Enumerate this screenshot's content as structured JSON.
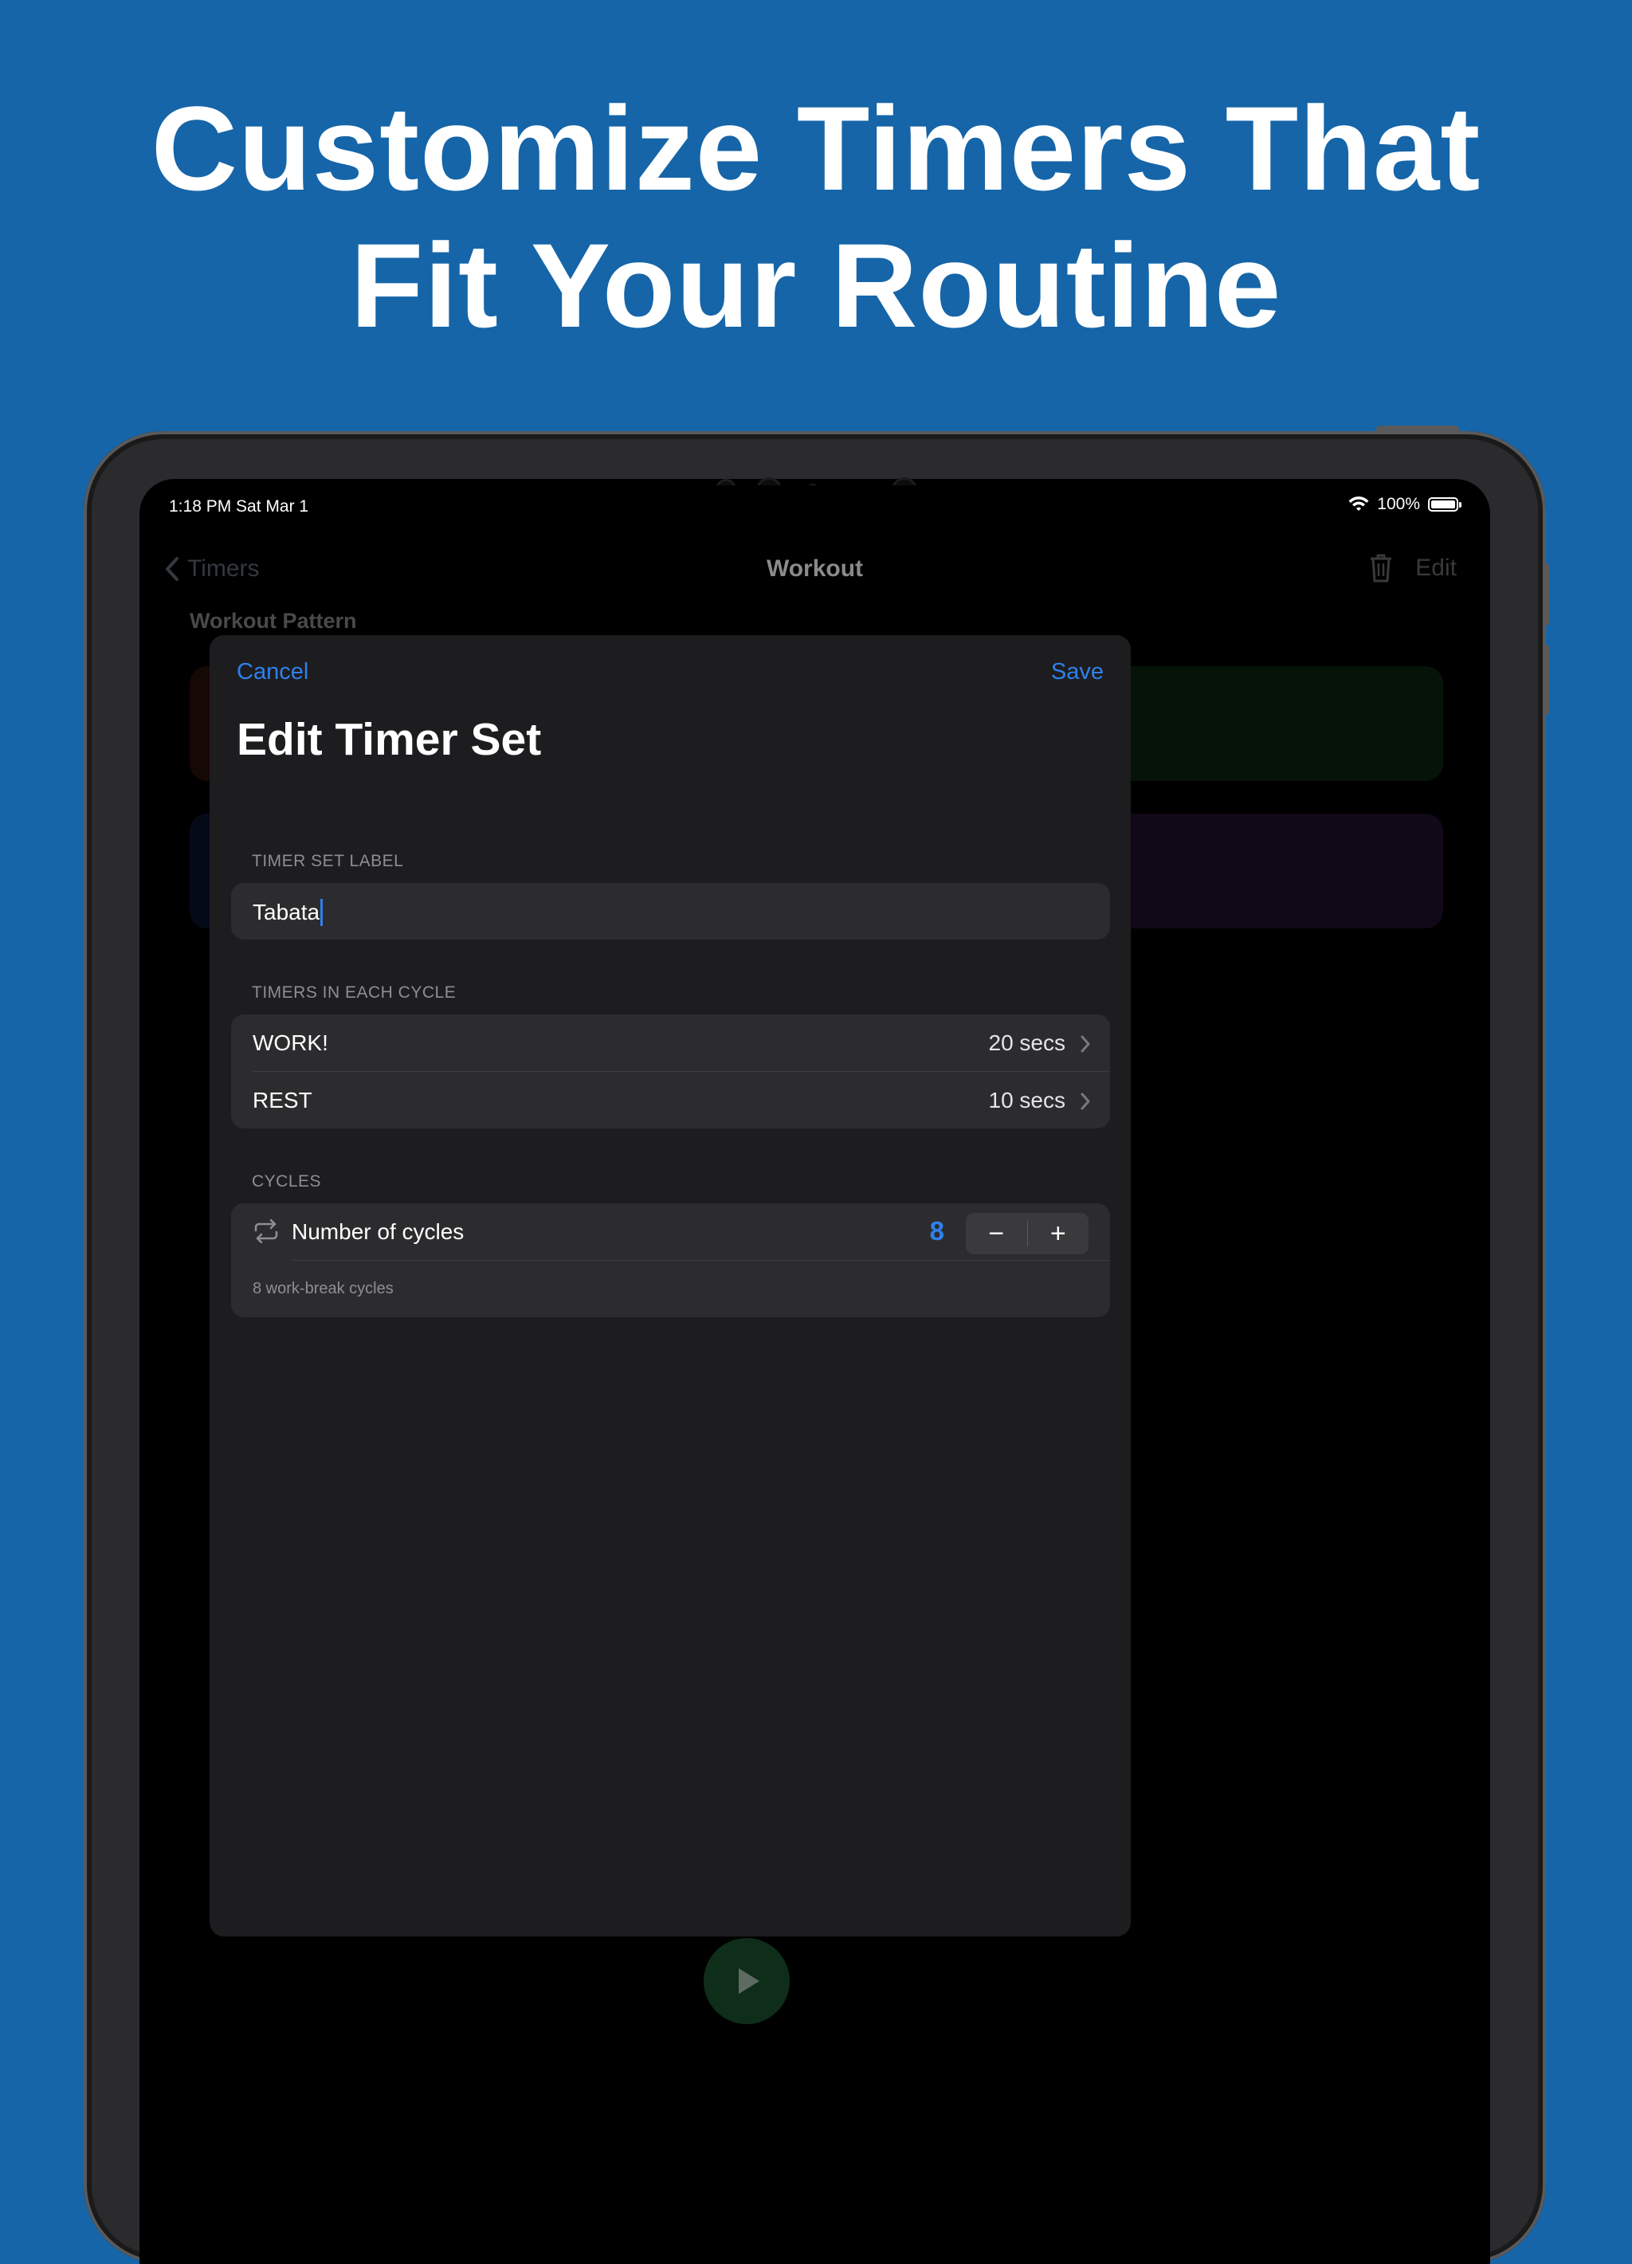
{
  "headline": {
    "line1": "Customize Timers That",
    "line2": "Fit Your Routine"
  },
  "status_bar": {
    "time_date": "1:18 PM   Sat Mar 1",
    "battery": "100%"
  },
  "background_nav": {
    "back_label": "Timers",
    "title": "Workout",
    "edit_label": "Edit",
    "section_label": "Workout Pattern"
  },
  "modal": {
    "cancel_label": "Cancel",
    "save_label": "Save",
    "title": "Edit Timer Set",
    "label_section": {
      "header": "TIMER SET LABEL",
      "value": "Tabata"
    },
    "timers_section": {
      "header": "TIMERS IN EACH CYCLE",
      "rows": [
        {
          "name": "WORK!",
          "value": "20 secs"
        },
        {
          "name": "REST",
          "value": "10 secs"
        }
      ]
    },
    "cycles_section": {
      "header": "CYCLES",
      "label": "Number of cycles",
      "value": "8",
      "minus": "−",
      "plus": "+",
      "footnote": "8 work-break cycles"
    }
  },
  "colors": {
    "background": "#1565a8",
    "accent": "#2f80ed",
    "modal_bg": "#1d1d1f",
    "card_bg": "#2c2c2e"
  },
  "icons": [
    "chevron-left-icon",
    "trash-icon",
    "wifi-icon",
    "battery-icon",
    "chevron-right-icon",
    "repeat-icon",
    "play-icon"
  ]
}
